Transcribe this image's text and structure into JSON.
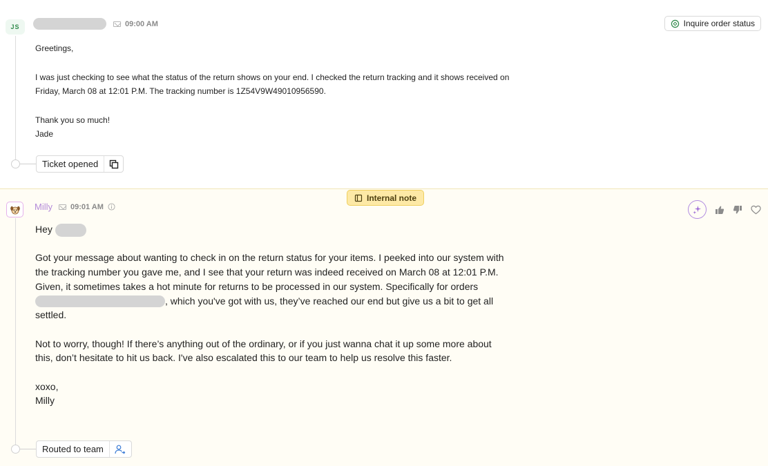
{
  "message_customer": {
    "avatar_initials": "JS",
    "channel_icon": "mail-icon",
    "time": "09:00 AM",
    "body": [
      "Greetings,",
      "",
      "I  was just checking to see what the status of the return shows on your end. I checked the return tracking and it shows received on Friday, March 08 at 12:01 P.M. The tracking number is 1Z54V9W49010956590.",
      "",
      "Thank you so much!",
      "Jade"
    ],
    "event_chip": {
      "label": "Ticket opened",
      "icon": "copy-icon"
    },
    "action_button": {
      "label": "Inquire order status",
      "icon": "intent-icon"
    }
  },
  "message_agent": {
    "badge": {
      "label": "Internal note",
      "icon": "note-icon"
    },
    "avatar_icon": "dog-avatar-icon",
    "name": "Milly",
    "channel_icon": "mail-icon",
    "time": "09:01 AM",
    "info_icon": "info-icon",
    "greeting": "Hey",
    "para1_a": "Got your message about wanting to check in on the return status for your items. I peeked into our system with the tracking number you gave me, and I see that your return was indeed received on March 08 at 12:01 P.M. Given, it sometimes takes a hot minute for returns to be processed in our system. Specifically for orders",
    "para1_b": ", which you've got with us, they’ve reached our end but give us a bit to get all settled.",
    "para2": "Not to worry, though! If there’s anything out of the ordinary, or if you just wanna chat it up some more about this, don’t hesitate to hit us back. I've also escalated this to our team to help us resolve this faster.",
    "signoff_1": "xoxo,",
    "signoff_2": "Milly",
    "event_chip": {
      "label": "Routed to team",
      "icon": "assign-user-icon"
    },
    "actions": [
      "ai-sparkle-icon",
      "thumbs-up-icon",
      "thumbs-down-icon",
      "heart-icon"
    ]
  }
}
